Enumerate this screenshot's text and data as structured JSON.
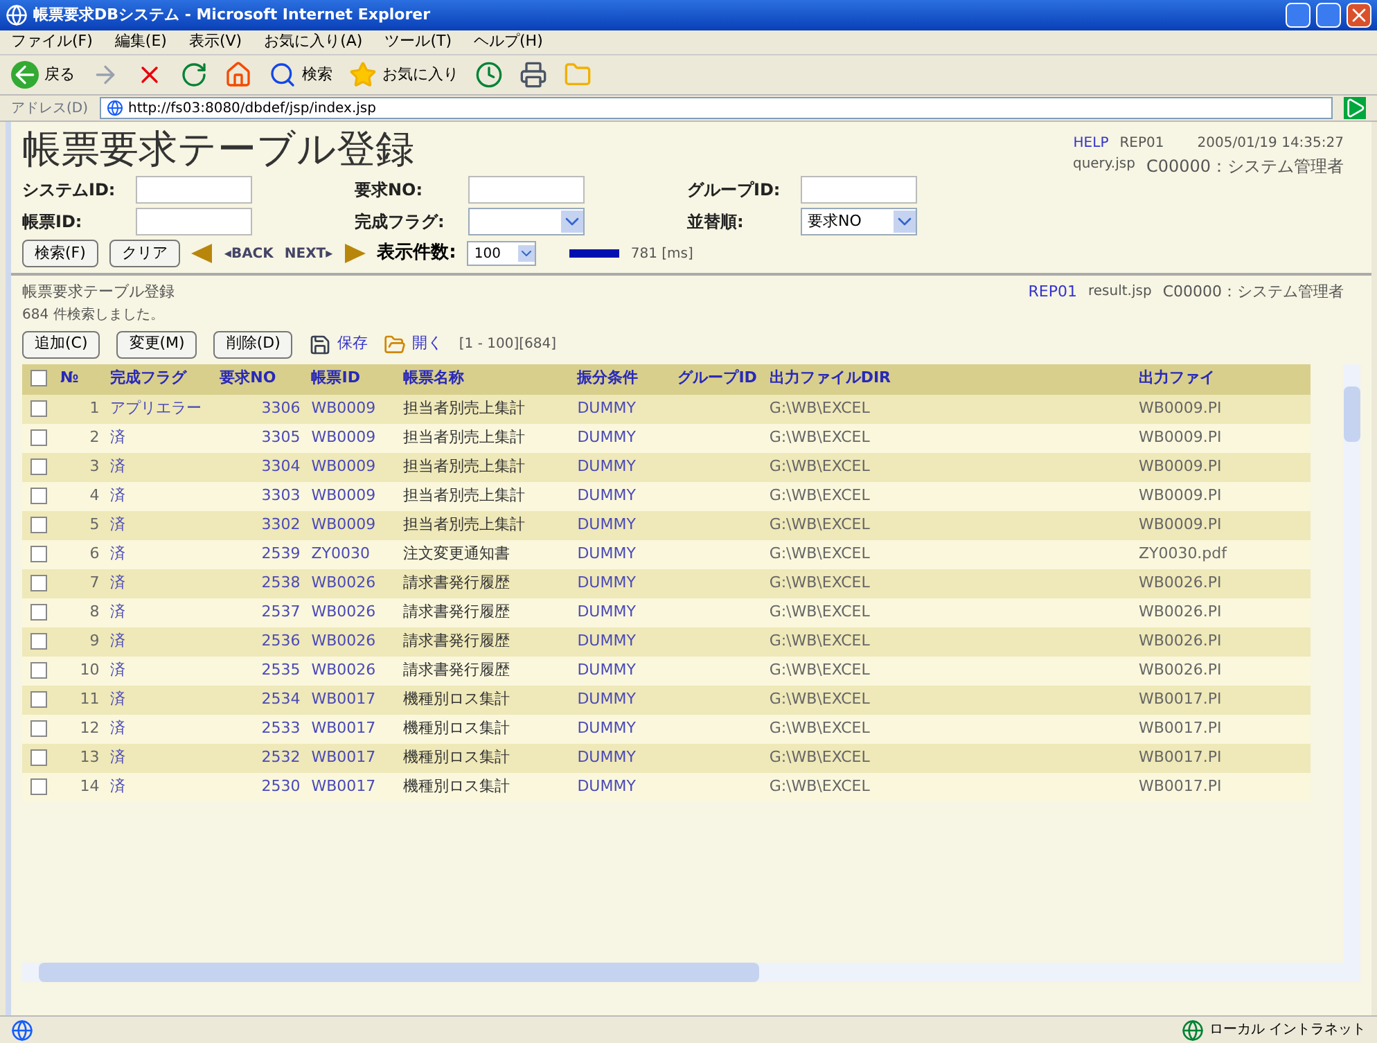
{
  "window": {
    "title": "帳票要求DBシステム - Microsoft Internet Explorer"
  },
  "menu": [
    "ファイル(F)",
    "編集(E)",
    "表示(V)",
    "お気に入り(A)",
    "ツール(T)",
    "ヘルプ(H)"
  ],
  "toolbar": {
    "back": "戻る",
    "search": "検索",
    "favorites": "お気に入り"
  },
  "address": {
    "label": "アドレス(D)",
    "value": "http://fs03:8080/dbdef/jsp/index.jsp"
  },
  "header": {
    "title": "帳票要求テーブル登録",
    "help": "HELP",
    "report": "REP01",
    "datetime": "2005/01/19 14:35:27",
    "page": "query.jsp",
    "user": "C00000：システム管理者"
  },
  "search_form": {
    "fields": [
      {
        "kind": "text",
        "label": "システムID:"
      },
      {
        "kind": "text",
        "label": "要求NO:"
      },
      {
        "kind": "text",
        "label": "グループID:"
      },
      {
        "kind": "text",
        "label": "帳票ID:"
      },
      {
        "kind": "select",
        "label": "完成フラグ:"
      },
      {
        "kind": "select",
        "label": "並替順:",
        "value": "要求NO"
      }
    ],
    "search_button": "検索(F)",
    "clear_button": "クリア",
    "back": "◂BACK",
    "next": "NEXT▸",
    "count_label": "表示件数:",
    "count_value": "100",
    "timing": "781 [ms]"
  },
  "result": {
    "title": "帳票要求テーブル登録",
    "report": "REP01",
    "page": "result.jsp",
    "user": "C00000：システム管理者",
    "message": "684 件検索しました。",
    "buttons": [
      "追加(C)",
      "変更(M)",
      "削除(D)"
    ],
    "save": "保存",
    "open": "開く",
    "range": "[1 - 100][684]"
  },
  "table": {
    "all_checked": false,
    "columns": [
      "№",
      "完成フラグ",
      "要求NO",
      "帳票ID",
      "帳票名称",
      "振分条件",
      "グループID",
      "出力ファイルDIR",
      "出力ファイ"
    ],
    "rows": [
      {
        "checked": false,
        "cells": [
          "1",
          "アプリエラー",
          "3306",
          "WB0009",
          "担当者別売上集計",
          "DUMMY",
          "",
          "G:\\WB\\EXCEL",
          "WB0009.PI"
        ]
      },
      {
        "checked": false,
        "cells": [
          "2",
          "済",
          "3305",
          "WB0009",
          "担当者別売上集計",
          "DUMMY",
          "",
          "G:\\WB\\EXCEL",
          "WB0009.PI"
        ]
      },
      {
        "checked": false,
        "cells": [
          "3",
          "済",
          "3304",
          "WB0009",
          "担当者別売上集計",
          "DUMMY",
          "",
          "G:\\WB\\EXCEL",
          "WB0009.PI"
        ]
      },
      {
        "checked": false,
        "cells": [
          "4",
          "済",
          "3303",
          "WB0009",
          "担当者別売上集計",
          "DUMMY",
          "",
          "G:\\WB\\EXCEL",
          "WB0009.PI"
        ]
      },
      {
        "checked": false,
        "cells": [
          "5",
          "済",
          "3302",
          "WB0009",
          "担当者別売上集計",
          "DUMMY",
          "",
          "G:\\WB\\EXCEL",
          "WB0009.PI"
        ]
      },
      {
        "checked": false,
        "cells": [
          "6",
          "済",
          "2539",
          "ZY0030",
          "注文変更通知書",
          "DUMMY",
          "",
          "G:\\WB\\EXCEL",
          "ZY0030.pdf"
        ]
      },
      {
        "checked": false,
        "cells": [
          "7",
          "済",
          "2538",
          "WB0026",
          "請求書発行履歴",
          "DUMMY",
          "",
          "G:\\WB\\EXCEL",
          "WB0026.PI"
        ]
      },
      {
        "checked": false,
        "cells": [
          "8",
          "済",
          "2537",
          "WB0026",
          "請求書発行履歴",
          "DUMMY",
          "",
          "G:\\WB\\EXCEL",
          "WB0026.PI"
        ]
      },
      {
        "checked": false,
        "cells": [
          "9",
          "済",
          "2536",
          "WB0026",
          "請求書発行履歴",
          "DUMMY",
          "",
          "G:\\WB\\EXCEL",
          "WB0026.PI"
        ]
      },
      {
        "checked": false,
        "cells": [
          "10",
          "済",
          "2535",
          "WB0026",
          "請求書発行履歴",
          "DUMMY",
          "",
          "G:\\WB\\EXCEL",
          "WB0026.PI"
        ]
      },
      {
        "checked": false,
        "cells": [
          "11",
          "済",
          "2534",
          "WB0017",
          "機種別ロス集計",
          "DUMMY",
          "",
          "G:\\WB\\EXCEL",
          "WB0017.PI"
        ]
      },
      {
        "checked": false,
        "cells": [
          "12",
          "済",
          "2533",
          "WB0017",
          "機種別ロス集計",
          "DUMMY",
          "",
          "G:\\WB\\EXCEL",
          "WB0017.PI"
        ]
      },
      {
        "checked": false,
        "cells": [
          "13",
          "済",
          "2532",
          "WB0017",
          "機種別ロス集計",
          "DUMMY",
          "",
          "G:\\WB\\EXCEL",
          "WB0017.PI"
        ]
      },
      {
        "checked": false,
        "cells": [
          "14",
          "済",
          "2530",
          "WB0017",
          "機種別ロス集計",
          "DUMMY",
          "",
          "G:\\WB\\EXCEL",
          "WB0017.PI"
        ]
      }
    ]
  },
  "status_bar": {
    "zone": "ローカル イントラネット"
  }
}
